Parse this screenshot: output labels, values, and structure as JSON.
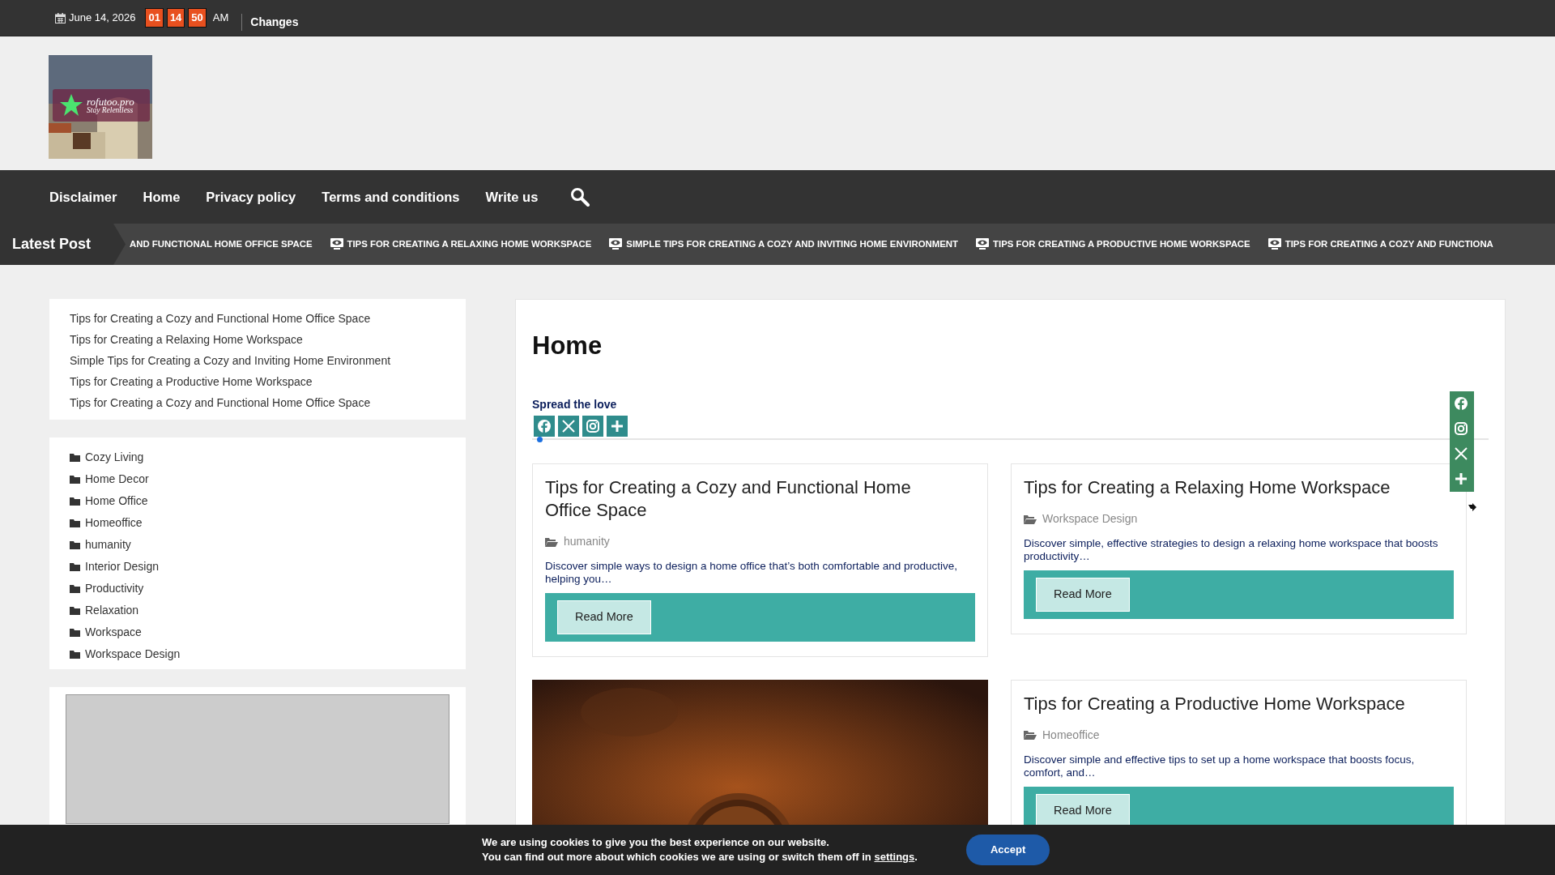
{
  "top_bar": {
    "date": "June 14, 2026",
    "clock": [
      "01",
      "14",
      "50"
    ],
    "meridiem": "AM",
    "headline": "Changes"
  },
  "logo": {
    "title": "rofutoo.pro",
    "tagline": "Stay Relentless"
  },
  "nav": {
    "items": [
      "Disclaimer",
      "Home",
      "Privacy policy",
      "Terms and conditions",
      "Write us"
    ]
  },
  "ticker": {
    "label": "Latest Post",
    "items": [
      {
        "text": "AND FUNCTIONAL HOME OFFICE SPACE",
        "icon": false
      },
      {
        "text": "TIPS FOR CREATING A RELAXING HOME WORKSPACE",
        "icon": true
      },
      {
        "text": "SIMPLE TIPS FOR CREATING A COZY AND INVITING HOME ENVIRONMENT",
        "icon": true
      },
      {
        "text": "TIPS FOR CREATING A PRODUCTIVE HOME WORKSPACE",
        "icon": true
      },
      {
        "text": "TIPS FOR CREATING A COZY AND FUNCTIONA",
        "icon": true
      }
    ]
  },
  "sidebar": {
    "recent_posts": [
      "Tips for Creating a Cozy and Functional Home Office Space",
      "Tips for Creating a Relaxing Home Workspace",
      "Simple Tips for Creating a Cozy and Inviting Home Environment",
      "Tips for Creating a Productive Home Workspace",
      "Tips for Creating a Cozy and Functional Home Office Space"
    ],
    "categories": [
      "Cozy Living",
      "Home Decor",
      "Home Office",
      "Homeoffice",
      "humanity",
      "Interior Design",
      "Productivity",
      "Relaxation",
      "Workspace",
      "Workspace Design"
    ]
  },
  "page": {
    "title": "Home",
    "share_label": "Spread the love"
  },
  "posts": [
    {
      "kind": "post",
      "title": "Tips for Creating a Cozy and Functional Home Office Space",
      "category": "humanity",
      "excerpt": "Discover simple ways to design a home office that’s both comfortable and productive, helping you…",
      "button": "Read More"
    },
    {
      "kind": "post",
      "title": "Tips for Creating a Relaxing Home Workspace",
      "category": "Workspace Design",
      "excerpt": "Discover simple, effective strategies to design a relaxing home workspace that boosts productivity…",
      "button": "Read More"
    },
    {
      "kind": "picture"
    },
    {
      "kind": "post",
      "title": "Tips for Creating a Productive Home Workspace",
      "category": "Homeoffice",
      "excerpt": "Discover simple and effective tips to set up a home workspace that boosts focus, comfort, and…",
      "button": "Read More"
    }
  ],
  "cookie": {
    "line1": "We are using cookies to give you the best experience on our website.",
    "line2": "You can find out more about which cookies we are using or switch them off in",
    "link": "settings",
    "end": ".",
    "button": "Accept"
  }
}
